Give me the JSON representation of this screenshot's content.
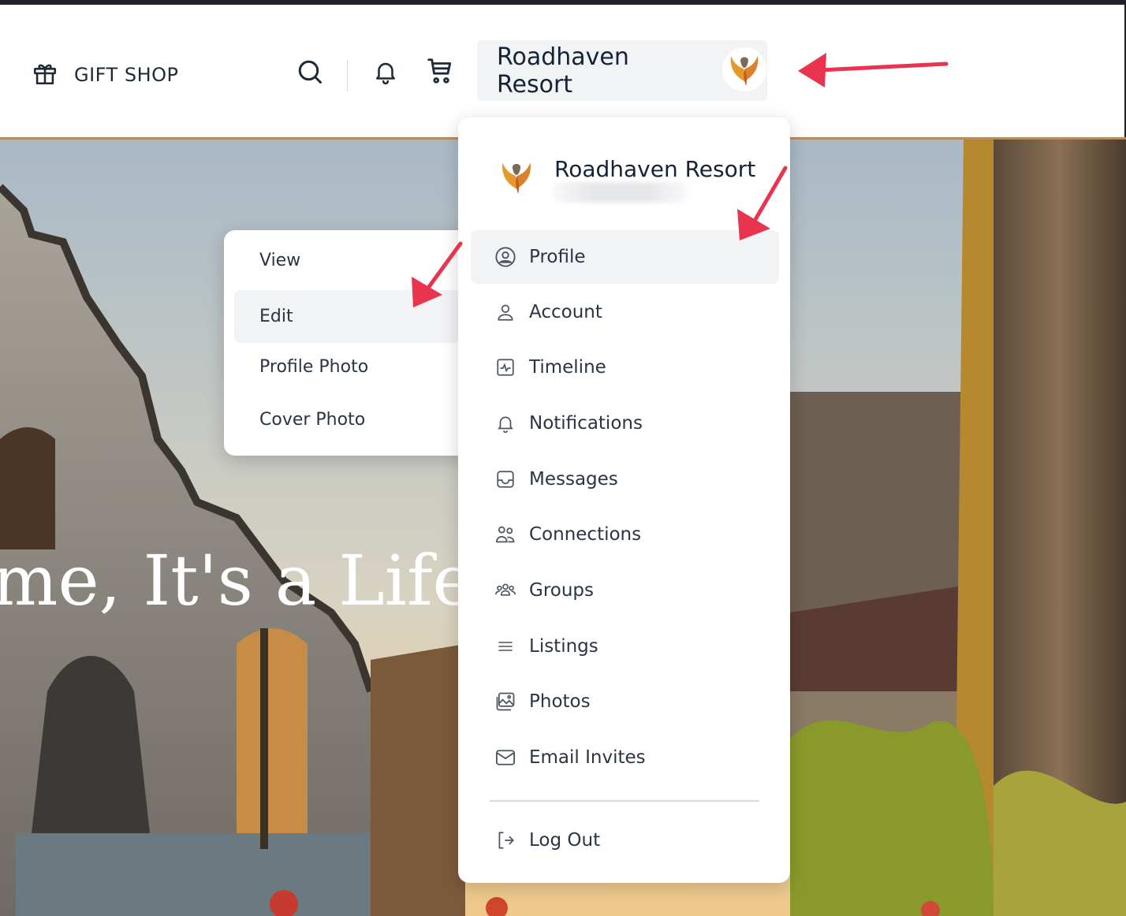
{
  "header": {
    "gift_shop_label": "GIFT SHOP",
    "user_button_name": "Roadhaven Resort"
  },
  "hero": {
    "overlay_text": "me, It's a Lifes"
  },
  "dropdown": {
    "account_name": "Roadhaven Resort",
    "items": [
      {
        "label": "Profile",
        "icon": "user-circle-icon"
      },
      {
        "label": "Account",
        "icon": "user-icon"
      },
      {
        "label": "Timeline",
        "icon": "activity-icon"
      },
      {
        "label": "Notifications",
        "icon": "bell-icon"
      },
      {
        "label": "Messages",
        "icon": "inbox-icon"
      },
      {
        "label": "Connections",
        "icon": "users-icon"
      },
      {
        "label": "Groups",
        "icon": "group-icon"
      },
      {
        "label": "Listings",
        "icon": "menu-lines-icon"
      },
      {
        "label": "Photos",
        "icon": "photos-icon"
      },
      {
        "label": "Email Invites",
        "icon": "mail-icon"
      }
    ],
    "logout_label": "Log Out"
  },
  "profile_submenu": {
    "items": [
      "View",
      "Edit",
      "Profile Photo",
      "Cover Photo"
    ]
  },
  "colors": {
    "header_rule": "#b98c5f",
    "annotation_arrow": "#e8344e",
    "active_bg": "#f2f3f5"
  }
}
